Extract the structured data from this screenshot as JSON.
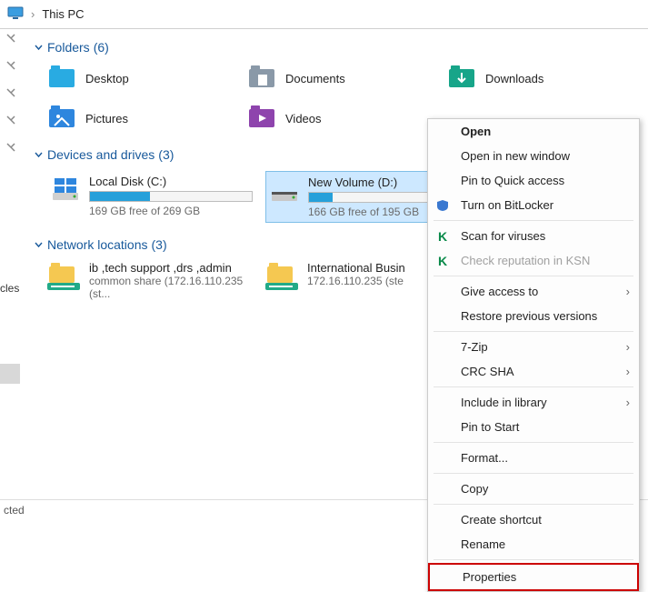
{
  "header": {
    "title": "This PC"
  },
  "groups": {
    "folders": {
      "label": "Folders",
      "count": 6
    },
    "drives": {
      "label": "Devices and drives",
      "count": 3
    },
    "network": {
      "label": "Network locations",
      "count": 3
    }
  },
  "folders": {
    "desktop": "Desktop",
    "documents": "Documents",
    "downloads": "Downloads",
    "pictures": "Pictures",
    "videos": "Videos"
  },
  "drives_list": {
    "c": {
      "name": "Local Disk (C:)",
      "free": "169 GB free of 269 GB",
      "fill": 37
    },
    "d": {
      "name": "New Volume (D:)",
      "free": "166 GB free of 195 GB",
      "fill": 15
    }
  },
  "network_items": {
    "a": {
      "line1": "ib ,tech support ,drs ,admin",
      "line2": "common share (172.16.110.235 (st..."
    },
    "b": {
      "line1": "International Busin",
      "line2": "172.16.110.235 (ste"
    }
  },
  "context_menu": {
    "open": "Open",
    "open_new": "Open in new window",
    "pin_quick": "Pin to Quick access",
    "bitlocker": "Turn on BitLocker",
    "scan": "Scan for viruses",
    "ksn": "Check reputation in KSN",
    "give_access": "Give access to",
    "restore": "Restore previous versions",
    "sevenzip": "7-Zip",
    "crc": "CRC SHA",
    "include_lib": "Include in library",
    "pin_start": "Pin to Start",
    "format": "Format...",
    "copy": "Copy",
    "shortcut": "Create shortcut",
    "rename": "Rename",
    "properties": "Properties"
  },
  "footer": {
    "selected": "cted"
  },
  "truncated_left": "cles"
}
